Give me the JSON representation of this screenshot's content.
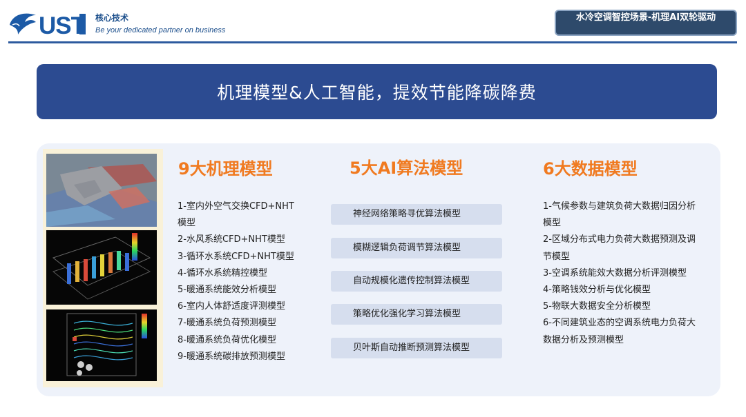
{
  "header": {
    "logo_text": "UST",
    "tagline_cn": "核心技术",
    "tagline_en": "Be your dedicated partner on business",
    "badge": "水冷空调智控场景-机理AI双轮驱动"
  },
  "banner": {
    "title": "机理模型&人工智能，提效节能降碳降费"
  },
  "mechanism": {
    "title": "9大机理模型",
    "items": [
      "1-室内外空气交换CFD+NHT",
      "模型",
      "2-水风系统CFD+NHT模型",
      "3-循环水系统CFD+NHT模型",
      "4-循环水系统精控模型",
      "5-暖通系统能效分析模型",
      "6-室内人体舒适度评测模型",
      "7-暖通系统负荷预测模型",
      "8-暖通系统负荷优化模型",
      "9-暖通系统碳排放预测模型"
    ]
  },
  "ai": {
    "title": "5大AI算法模型",
    "items": [
      "神经网络策略寻优算法模型",
      "模糊逻辑负荷调节算法模型",
      "自动规模化遗传控制算法模型",
      "策略优化强化学习算法模型",
      "贝叶斯自动推断预测算法模型"
    ]
  },
  "data": {
    "title": "6大数据模型",
    "items": [
      "1-气候参数与建筑负荷大数据归因分析",
      "模型",
      "2-区域分布式电力负荷大数据预测及调",
      "节模型",
      "3-空调系统能效大数据分析评测模型",
      "4-策略钱效分析与优化模型",
      "5-物联大数据安全分析模型",
      "6-不同建筑业态的空调系统电力负荷大",
      "数据分析及预测模型"
    ]
  }
}
